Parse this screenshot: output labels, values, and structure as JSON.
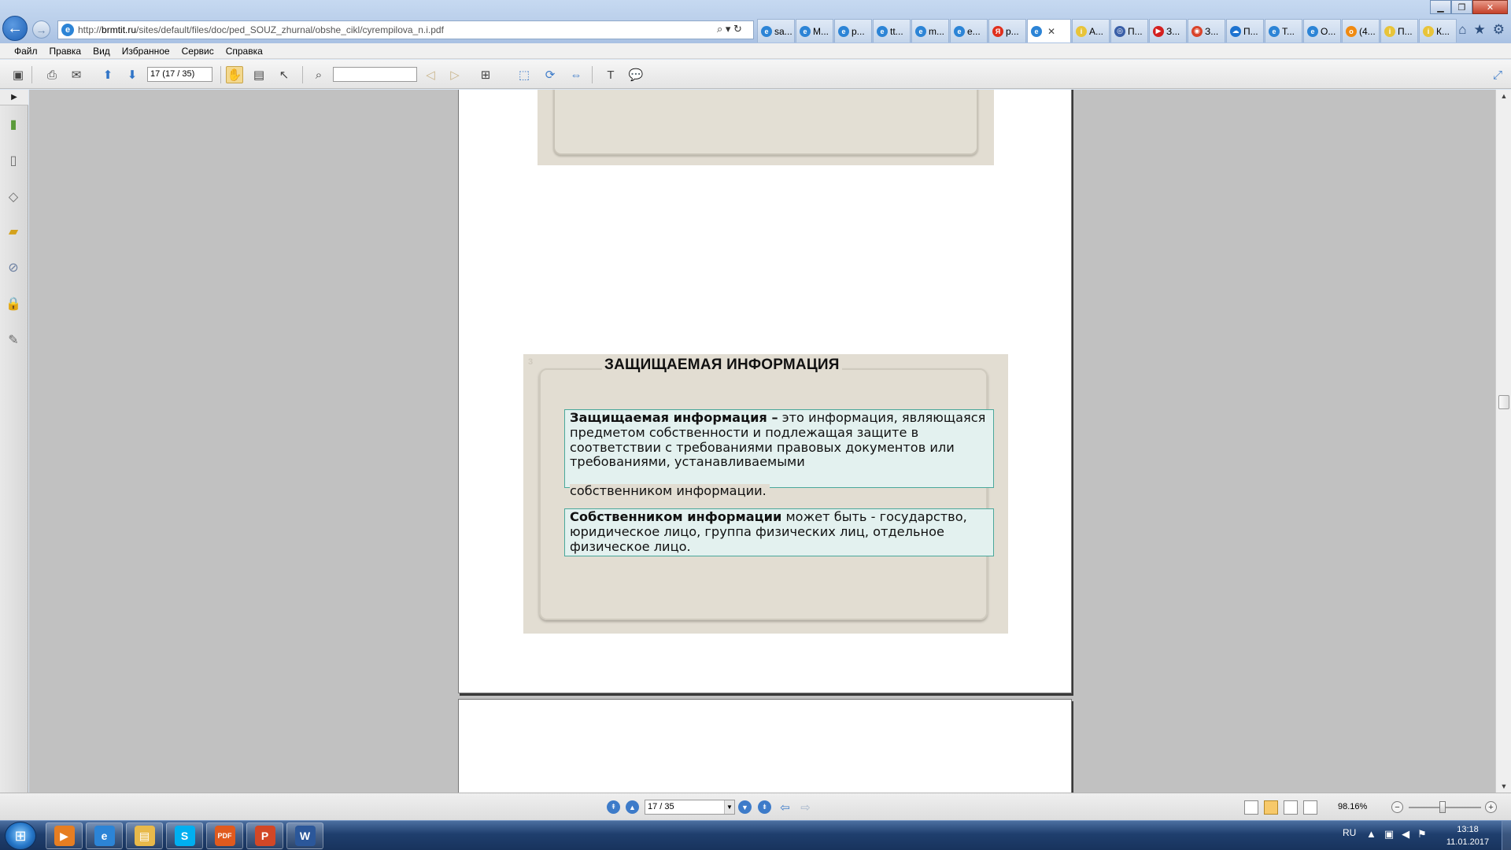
{
  "browser": {
    "address_prefix": "http://",
    "address_host": "brmtit.ru",
    "address_path": "/sites/default/files/doc/ped_SOUZ_zhurnal/obshe_cikl/cyrempilova_n.i.pdf",
    "address_tools": "⌕ ▾ ↻",
    "tabs": [
      {
        "label": "sa...",
        "icon": "e",
        "color": "#2c84d6"
      },
      {
        "label": "М...",
        "icon": "e",
        "color": "#2c84d6"
      },
      {
        "label": "р...",
        "icon": "e",
        "color": "#2c84d6"
      },
      {
        "label": "tt...",
        "icon": "e",
        "color": "#2c84d6"
      },
      {
        "label": "m...",
        "icon": "e",
        "color": "#2c84d6"
      },
      {
        "label": "e...",
        "icon": "e",
        "color": "#2c84d6"
      },
      {
        "label": "р...",
        "icon": "Я",
        "color": "#e0301e"
      },
      {
        "label": "",
        "icon": "e",
        "color": "#2c84d6",
        "active": true
      },
      {
        "label": "А...",
        "icon": "i",
        "color": "#e8c43a"
      },
      {
        "label": "П...",
        "icon": "◎",
        "color": "#3a5fa8"
      },
      {
        "label": "З...",
        "icon": "▶",
        "color": "#d42020"
      },
      {
        "label": "З...",
        "icon": "◉",
        "color": "#d9432a"
      },
      {
        "label": "П...",
        "icon": "☁",
        "color": "#1e73d0"
      },
      {
        "label": "Т...",
        "icon": "e",
        "color": "#2c84d6"
      },
      {
        "label": "О...",
        "icon": "e",
        "color": "#2c84d6"
      },
      {
        "label": "(4...",
        "icon": "о",
        "color": "#f08a12"
      },
      {
        "label": "П...",
        "icon": "i",
        "color": "#e8c43a"
      },
      {
        "label": "К...",
        "icon": "i",
        "color": "#e8c43a"
      }
    ],
    "active_tab_close": "✕"
  },
  "menu": [
    "Файл",
    "Правка",
    "Вид",
    "Избранное",
    "Сервис",
    "Справка"
  ],
  "toolbar": {
    "page_value": "17 (17 / 35)",
    "find_value": ""
  },
  "document": {
    "slide_number": "3",
    "slide_title": "ЗАЩИЩАЕМАЯ ИНФОРМАЦИЯ",
    "box1_bold": "Защищаемая  информация –",
    "box1_text": " это информация, являющаяся предметом собственности и подлежащая защите в соответствии с требованиями правовых документов или требованиями,  устанавливаемыми",
    "box1_tail": "собственником информации.",
    "box2_bold": "Собственником информации",
    "box2_text": " может быть - государство, юридическое лицо, группа физических лиц, отдельное физическое лицо.",
    "page_number": "17"
  },
  "statusbar": {
    "page_nav_value": "17 / 35",
    "zoom": "98.16%"
  },
  "taskbar": {
    "apps": [
      {
        "name": "media-player",
        "label": "▶",
        "color": "#e67e22"
      },
      {
        "name": "internet-explorer",
        "label": "e",
        "color": "#2c84d6"
      },
      {
        "name": "file-explorer",
        "label": "▤",
        "color": "#e8b94a"
      },
      {
        "name": "skype",
        "label": "S",
        "color": "#00aff0"
      },
      {
        "name": "pdf-reader",
        "label": "PDF",
        "color": "#e05a1e"
      },
      {
        "name": "powerpoint",
        "label": "P",
        "color": "#d24726"
      },
      {
        "name": "word",
        "label": "W",
        "color": "#2b579a"
      }
    ],
    "language": "RU",
    "time": "13:18",
    "date": "11.01.2017"
  }
}
